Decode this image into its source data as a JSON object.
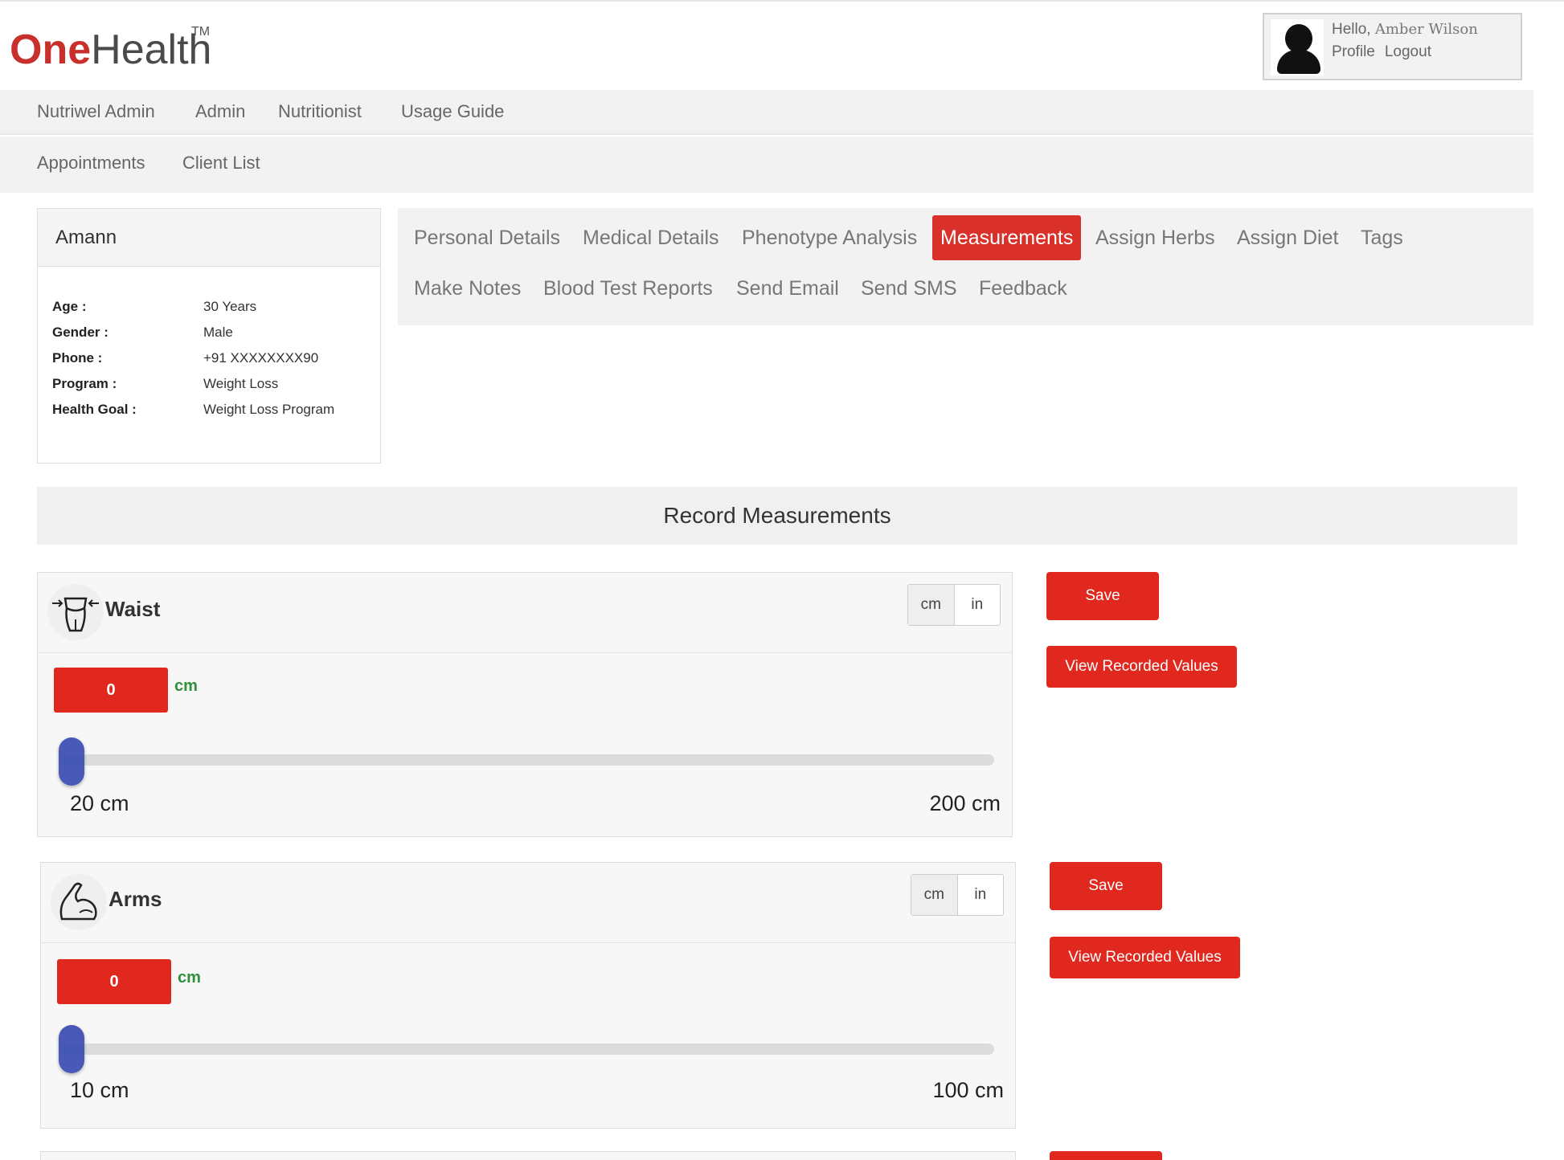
{
  "brand": {
    "logo_o": "O",
    "logo_ne": "ne",
    "logo_health": "Health",
    "logo_tm": "TM"
  },
  "user": {
    "greeting": "Hello,",
    "name": "Amber Wilson",
    "profile": "Profile",
    "logout": "Logout"
  },
  "nav_primary": [
    "Nutriwel Admin",
    "Admin",
    "Nutritionist",
    "Usage Guide"
  ],
  "nav_secondary": [
    "Appointments",
    "Client List"
  ],
  "client": {
    "name": "Amann",
    "fields": [
      {
        "label": "Age :",
        "value": "30 Years"
      },
      {
        "label": "Gender :",
        "value": "Male"
      },
      {
        "label": "Phone :",
        "value": "+91 XXXXXXXX90"
      },
      {
        "label": "Program :",
        "value": "Weight Loss"
      },
      {
        "label": "Health Goal :",
        "value": "Weight Loss Program"
      }
    ]
  },
  "tabs": {
    "row1": [
      "Personal Details",
      "Medical Details",
      "Phenotype Analysis",
      "Measurements",
      "Assign Herbs",
      "Assign Diet",
      "Tags"
    ],
    "row2": [
      "Make Notes",
      "Blood Test Reports",
      "Send Email",
      "Send SMS",
      "Feedback"
    ],
    "active": "Measurements"
  },
  "record_title": "Record Measurements",
  "measurements": [
    {
      "name": "Waist",
      "icon": "waist-icon",
      "unit_cm": "cm",
      "unit_in": "in",
      "value": "0",
      "unit_label": "cm",
      "min_label": "20 cm",
      "max_label": "200 cm",
      "slider_fraction": 0,
      "save": "Save",
      "view": "View Recorded Values"
    },
    {
      "name": "Arms",
      "icon": "arm-icon",
      "unit_cm": "cm",
      "unit_in": "in",
      "value": "0",
      "unit_label": "cm",
      "min_label": "10 cm",
      "max_label": "100 cm",
      "slider_fraction": 0,
      "save": "Save",
      "view": "View Recorded Values"
    }
  ],
  "colors": {
    "accent": "#e0281e",
    "slider_thumb": "#3f51b5",
    "unit_green": "#2f8f3b"
  }
}
